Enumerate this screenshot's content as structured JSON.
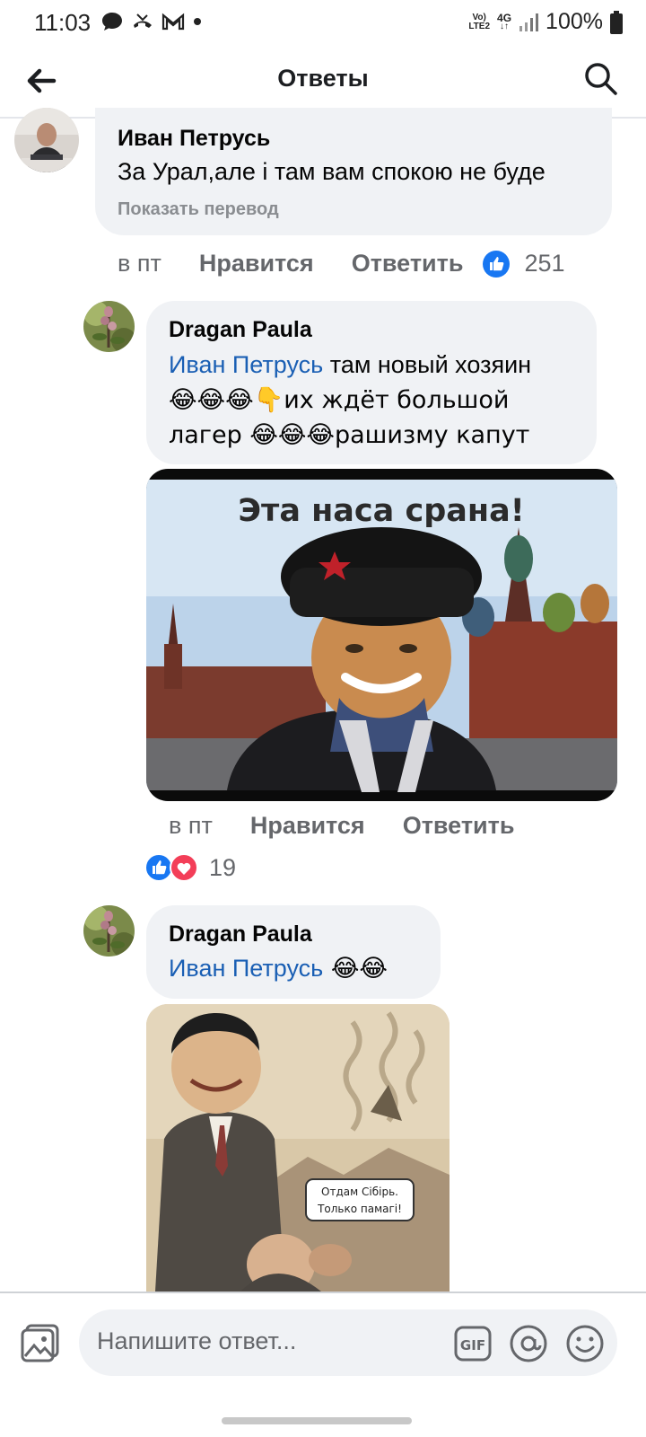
{
  "status_bar": {
    "time": "11:03",
    "network_top": "Vo)",
    "network_bottom": "LTE2",
    "network_type": "4G",
    "battery": "100%",
    "icons": [
      "message-icon",
      "missed-call-icon",
      "gmail-icon",
      "dot-icon",
      "signal-icon",
      "battery-icon"
    ]
  },
  "header": {
    "title": "Ответы",
    "back_icon": "arrow-left-icon",
    "search_icon": "search-icon"
  },
  "comments": [
    {
      "author": "Иван Петрусь",
      "text": "За Урал,але і там вам спокою не буде",
      "translate_label": "Показать перевод",
      "time": "в пт",
      "like_label": "Нравится",
      "reply_label": "Ответить",
      "reaction_count": "251",
      "reaction_icons": [
        "like-icon"
      ]
    },
    {
      "author": "Dragan Paula",
      "mention": "Иван Петрусь",
      "text_line1": " там новый хозяин",
      "text_line2": "😂😂😂👇их ждёт большой",
      "text_line3": "лагер 😂😂😂рашизму капут",
      "image_caption": "Эта наса срана!",
      "time": "в пт",
      "like_label": "Нравится",
      "reply_label": "Ответить",
      "reaction_count": "19",
      "reaction_icons": [
        "like-icon",
        "love-icon"
      ]
    },
    {
      "author": "Dragan Paula",
      "mention": "Иван Петрусь",
      "text": " 😂😂",
      "image_speech_line1": "Отдам Сібірь.",
      "image_speech_line2": "Только памагі!"
    }
  ],
  "composer": {
    "placeholder": "Напишите ответ...",
    "photo_icon": "photo-icon",
    "gif_label": "GIF",
    "at_icon": "at-icon",
    "emoji_icon": "smiley-icon"
  },
  "colors": {
    "accent": "#1877f2",
    "mention": "#1a5fb4",
    "bubble": "#f0f2f5",
    "love": "#f33e58"
  }
}
